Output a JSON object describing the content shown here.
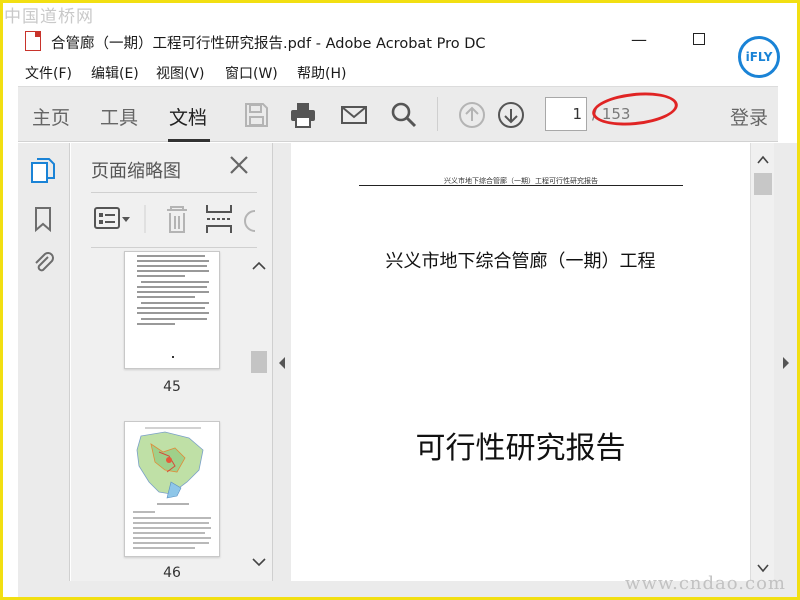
{
  "watermark": {
    "top": "中国道桥网",
    "bottom": "www.cndao.com"
  },
  "window": {
    "title": "合管廊（一期）工程可行性研究报告.pdf - Adobe Acrobat Pro DC",
    "overlay_logo": "iFLY"
  },
  "menu": [
    "文件(F)",
    "编辑(E)",
    "视图(V)",
    "窗口(W)",
    "帮助(H)"
  ],
  "toolbar": {
    "tabs": [
      "主页",
      "工具",
      "文档"
    ],
    "active_tab": "文档",
    "page_current": "1",
    "page_total": "/ 153",
    "login": "登录",
    "icons": [
      "save-icon",
      "print-icon",
      "email-icon",
      "search-icon",
      "page-up-icon",
      "page-down-icon"
    ]
  },
  "sidebar": {
    "panel_title": "页面缩略图",
    "thumbnails": [
      {
        "page": "45"
      },
      {
        "page": "46"
      }
    ]
  },
  "document": {
    "header": "兴义市地下综合管廊（一期）工程可行性研究报告",
    "title1": "兴义市地下综合管廊（一期）工程",
    "title2": "可行性研究报告"
  },
  "colors": {
    "accent": "#1a83d6",
    "annotation": "#e02424",
    "border": "#f2df12"
  }
}
